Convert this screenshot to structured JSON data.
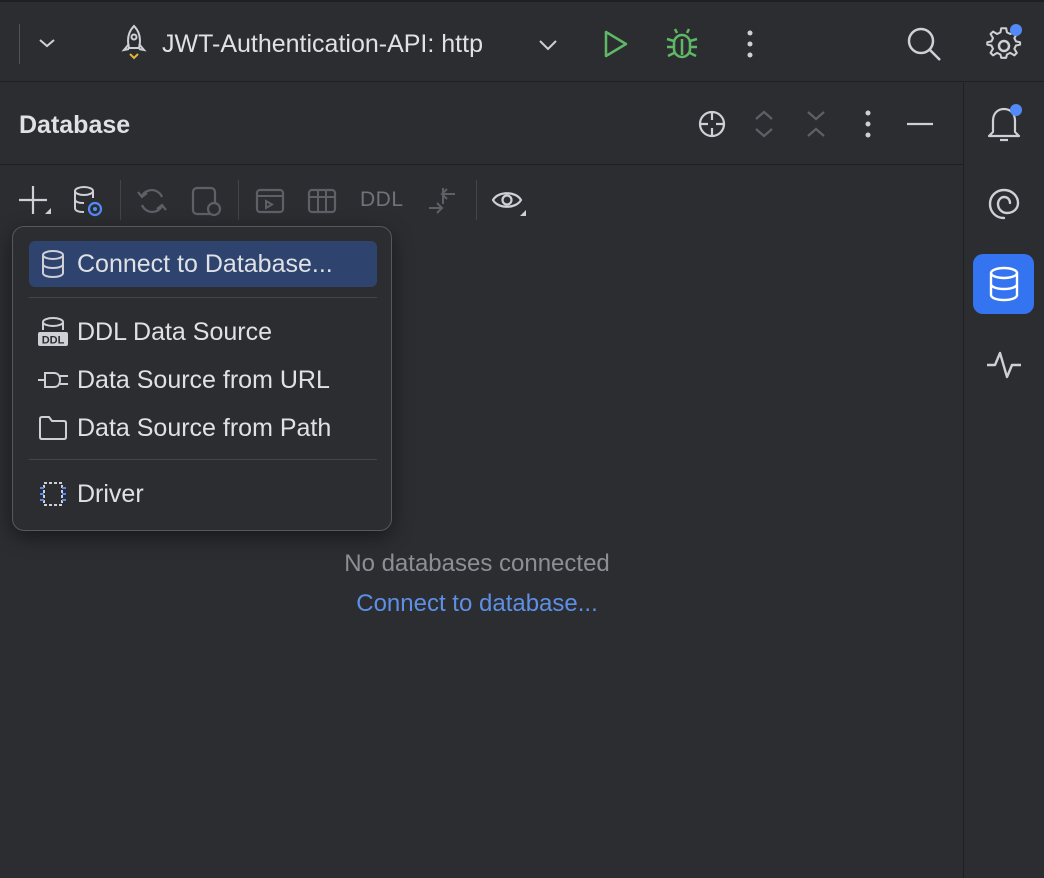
{
  "toolbar": {
    "run_config": "JWT-Authentication-API: http",
    "colors": {
      "run": "#5fb865",
      "debug": "#5fb865",
      "badge": "#548af7"
    }
  },
  "panel": {
    "title": "Database",
    "ddl_button": "DDL"
  },
  "add_menu": {
    "items": [
      {
        "label": "Connect to Database...",
        "icon": "database-icon",
        "selected": true
      },
      {
        "label": "DDL Data Source",
        "icon": "ddl-icon"
      },
      {
        "label": "Data Source from URL",
        "icon": "plug-icon"
      },
      {
        "label": "Data Source from Path",
        "icon": "folder-icon"
      },
      {
        "label": "Driver",
        "icon": "driver-icon"
      }
    ]
  },
  "empty_state": {
    "message": "No databases connected",
    "link": "Connect to database..."
  },
  "right_strip": {
    "items": [
      "notifications-icon",
      "ai-assistant-icon",
      "database-icon",
      "profiler-icon"
    ],
    "active": "database-icon"
  }
}
